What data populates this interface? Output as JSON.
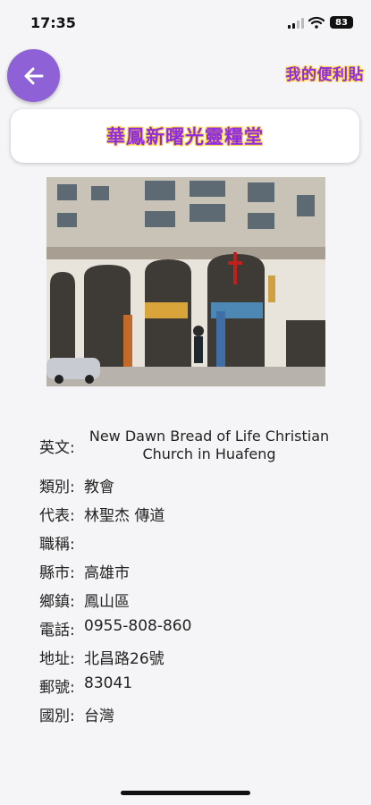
{
  "status_bar": {
    "time": "17:35",
    "battery": "83"
  },
  "header": {
    "back_icon": "arrow-left-icon",
    "notes_label": "我的便利貼"
  },
  "title": "華鳳新曙光靈糧堂",
  "details": {
    "english": {
      "label": "英文:",
      "value": "New Dawn Bread of Life Christian Church in Huafeng"
    },
    "category": {
      "label": "類別:",
      "value": "教會"
    },
    "representative": {
      "label": "代表:",
      "value": "林聖杰 傳道"
    },
    "title_role": {
      "label": "職稱:",
      "value": ""
    },
    "city": {
      "label": "縣市:",
      "value": "高雄市"
    },
    "township": {
      "label": "鄉鎮:",
      "value": "鳳山區"
    },
    "phone": {
      "label": "電話:",
      "value": "0955-808-860"
    },
    "address": {
      "label": "地址:",
      "value": "北昌路26號"
    },
    "postal": {
      "label": "郵號:",
      "value": "83041"
    },
    "country": {
      "label": "國別:",
      "value": "台灣"
    }
  },
  "colors": {
    "accent": "#8e62d6",
    "title_purple": "#8e2ce0",
    "title_outline": "#ffd54a"
  }
}
